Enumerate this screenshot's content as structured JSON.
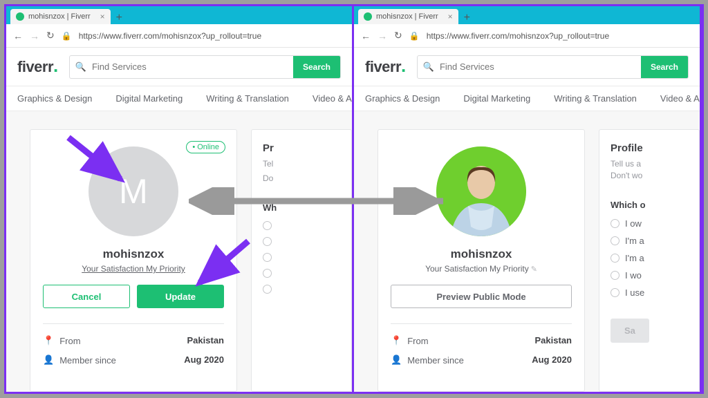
{
  "browser": {
    "tab_title": "mohisnzox | Fiverr",
    "url": "https://www.fiverr.com/mohisnzox?up_rollout=true"
  },
  "header": {
    "logo": "fiverr",
    "search_placeholder": "Find Services",
    "search_button": "Search"
  },
  "categories": [
    "Graphics & Design",
    "Digital Marketing",
    "Writing & Translation",
    "Video & Animation"
  ],
  "left": {
    "online": "Online",
    "avatar_letter": "M",
    "username": "mohisnzox",
    "tagline": "Your Satisfaction My Priority",
    "cancel": "Cancel",
    "update": "Update",
    "from_label": "From",
    "from_value": "Pakistan",
    "member_label": "Member since",
    "member_value": "Aug 2020",
    "side_heading_1": "Pr",
    "side_heading_2": "Tel",
    "side_heading_3": "Do",
    "side_q": "Wh"
  },
  "right": {
    "username": "mohisnzox",
    "tagline": "Your Satisfaction My Priority",
    "preview": "Preview Public Mode",
    "from_label": "From",
    "from_value": "Pakistan",
    "member_label": "Member since",
    "member_value": "Aug 2020",
    "side_heading": "Profile",
    "side_hint1": "Tell us a",
    "side_hint2": "Don't wo",
    "side_q": "Which o",
    "opts": [
      "I ow",
      "I'm a",
      "I'm a",
      "I wo",
      "I use"
    ],
    "save": "Sa"
  }
}
